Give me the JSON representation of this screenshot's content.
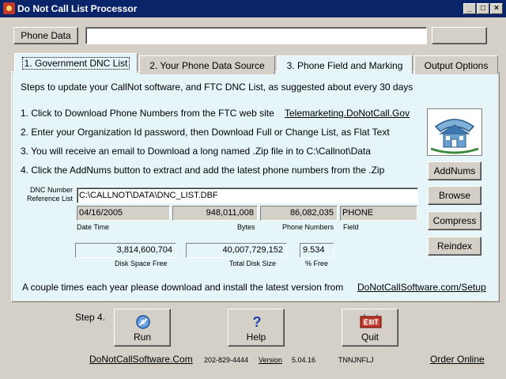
{
  "window": {
    "title": "Do Not Call List Processor"
  },
  "toolbar": {
    "phone_data_button": "Phone Data",
    "phone_data_input": "",
    "right_button": ""
  },
  "tabs": [
    {
      "label": "1. Government  DNC List"
    },
    {
      "label": "2. Your Phone Data Source"
    },
    {
      "label": "3. Phone Field and Marking"
    },
    {
      "label": "Output Options"
    }
  ],
  "panel": {
    "intro": "Steps to update your CallNot software, and FTC DNC List, as suggested about every 30 days",
    "step1_text": "1. Click to Download Phone Numbers from the FTC web site",
    "step1_link": "Telemarketing.DoNotCall.Gov",
    "step2_text": "2.  Enter your Organization Id password, then Download Full or Change List, as Flat Text",
    "step3_text": "3.  You will receive an email to Download a long named .Zip file in to C:\\Callnot\\Data",
    "step4_text": "4.  Click the AddNums button to extract and add the latest phone numbers from the .Zip",
    "dnc_label": "DNC Number Reference List",
    "dnc_path": "C:\\CALLNOT\\DATA\\DNC_LIST.DBF",
    "date_time": "04/16/2005",
    "date_time_label": "Date Time",
    "bytes": "948,011,008",
    "bytes_label": "Bytes",
    "phone_numbers": "86,082,035",
    "phone_numbers_label": "Phone Numbers",
    "field": "PHONE",
    "field_label": "Field",
    "disk_space_free": "3,814,600,704",
    "disk_space_free_label": "Disk Space Free",
    "total_disk_size": "40,007,729,152",
    "total_disk_size_label": "Total Disk Size",
    "pct_free": "9.534",
    "pct_free_label": "% Free",
    "footer_text": "A couple times each year please download and install the latest version from",
    "footer_link": "DoNotCallSoftware.com/Setup",
    "buttons": {
      "addnums": "AddNums",
      "browse": "Browse",
      "compress": "Compress",
      "reindex": "Reindex"
    }
  },
  "bottom": {
    "step_label": "Step 4.",
    "run": "Run",
    "help": "Help",
    "quit": "Quit",
    "site_link": "DoNotCallSoftware.Com",
    "phone": "202-829-4444",
    "version_label": "Version",
    "version": "5.04.16",
    "code": "TNNJNFLJ",
    "order_link": "Order Online"
  }
}
